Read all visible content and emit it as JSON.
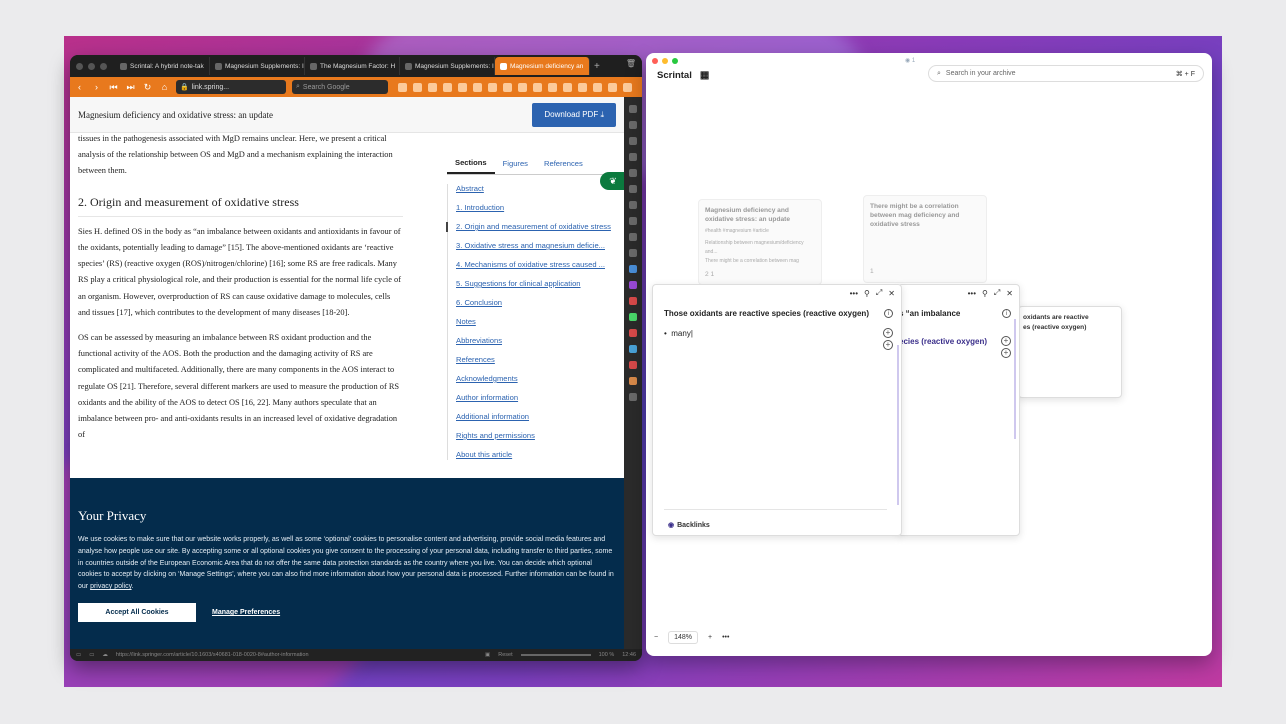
{
  "browser": {
    "tabs": [
      {
        "label": "Scrintal: A hybrid note-tak"
      },
      {
        "label": "Magnesium Supplements: I"
      },
      {
        "label": "The Magnesium Factor: H"
      },
      {
        "label": "Magnesium Supplements: I"
      },
      {
        "label": "Magnesium deficiency an"
      }
    ],
    "url": "link.spring...",
    "search_placeholder": "Search Google",
    "status_url": "https://link.springer.com/article/10.1603/s40681-018-0020-8#author-information",
    "status_reset": "Reset",
    "status_zoom": "100 %",
    "status_time": "12:46"
  },
  "page": {
    "header_title": "Magnesium deficiency and oxidative stress: an update",
    "download_label": "Download PDF",
    "intro_text": "tissues in the pathogenesis associated with MgD remains unclear. Here, we present a critical analysis of the relationship between OS and MgD and a mechanism explaining the interaction between them.",
    "section_heading": "2. Origin and measurement of oxidative stress",
    "para1": "Sies H. defined OS in the body as “an imbalance between oxidants and antioxidants in favour of the oxidants, potentially leading to damage” [15]. The above-mentioned oxidants are ‘reactive species’ (RS) (reactive oxygen (ROS)/nitrogen/chlorine) [16]; some RS are free radicals. Many RS play a critical physiological role, and their production is essential for the normal life cycle of an organism. However, overproduction of RS can cause oxidative damage to molecules, cells and tissues [17], which contributes to the development of many diseases [18-20].",
    "para2": "OS can be assessed by measuring an imbalance between RS oxidant production and the functional activity of the AOS. Both the production and the damaging activity of RS are complicated and multifaceted. Additionally, there are many components in the AOS interact to regulate OS [21]. Therefore, several different markers are used to measure the production of RS oxidants and the ability of the AOS to detect OS [16, 22]. Many authors speculate that an imbalance between pro- and anti-oxidants results in an increased level of oxidative degradation of",
    "toc_tabs": [
      "Sections",
      "Figures",
      "References"
    ],
    "toc_items": [
      "Abstract",
      "1. Introduction",
      "2. Origin and measurement of oxidative stress",
      "3. Oxidative stress and magnesium deficie...",
      "4. Mechanisms of oxidative stress caused ...",
      "5. Suggestions for clinical application",
      "6. Conclusion",
      "Notes",
      "Abbreviations",
      "References",
      "Acknowledgments",
      "Author information",
      "Additional information",
      "Rights and permissions",
      "About this article"
    ]
  },
  "privacy": {
    "title": "Your Privacy",
    "body": "We use cookies to make sure that our website works properly, as well as some ‘optional’ cookies to personalise content and advertising, provide social media features and analyse how people use our site. By accepting some or all optional cookies you give consent to the processing of your personal data, including transfer to third parties, some in countries outside of the European Economic Area that do not offer the same data protection standards as the country where you live. You can decide which optional cookies to accept by clicking on ‘Manage Settings’, where you can also find more information about how your personal data is processed. Further information can be found in our",
    "policy_link": "privacy policy",
    "accept_label": "Accept All Cookies",
    "manage_label": "Manage Preferences"
  },
  "scrintal": {
    "brand": "Scrintal",
    "search_placeholder": "Search in your archive",
    "search_shortcut": "⌘ + F",
    "top_badge": "1",
    "ghost_card1_title": "Magnesium deficiency and oxidative stress: an update",
    "ghost_card1_tags": "#health #magnesium #article",
    "ghost_card1_line1": "Relationship between magnesium/deficiency and...",
    "ghost_card1_line2": "There might be a correlation between mag",
    "ghost_card1_counts": "2   1",
    "ghost_card2_title": "There might be a correlation between mag deficiency and oxidative stress",
    "ghost_card2_count": "1",
    "panel1_title": "Those oxidants are reactive species (reactive oxygen)",
    "panel1_bullet": "many",
    "panel1_backlinks": "Backlinks",
    "panel2_title": "s “an imbalance",
    "panel2_sub": "ecies (reactive oxygen)",
    "panel3_text": "oxidants are reactive\nes (reactive oxygen)",
    "zoom": "148%"
  },
  "colors": {
    "browser_accent": "#e8791d",
    "springer_blue": "#2c63b0",
    "privacy_bg": "#042c4c",
    "panel_accent": "#cfc8ee"
  }
}
